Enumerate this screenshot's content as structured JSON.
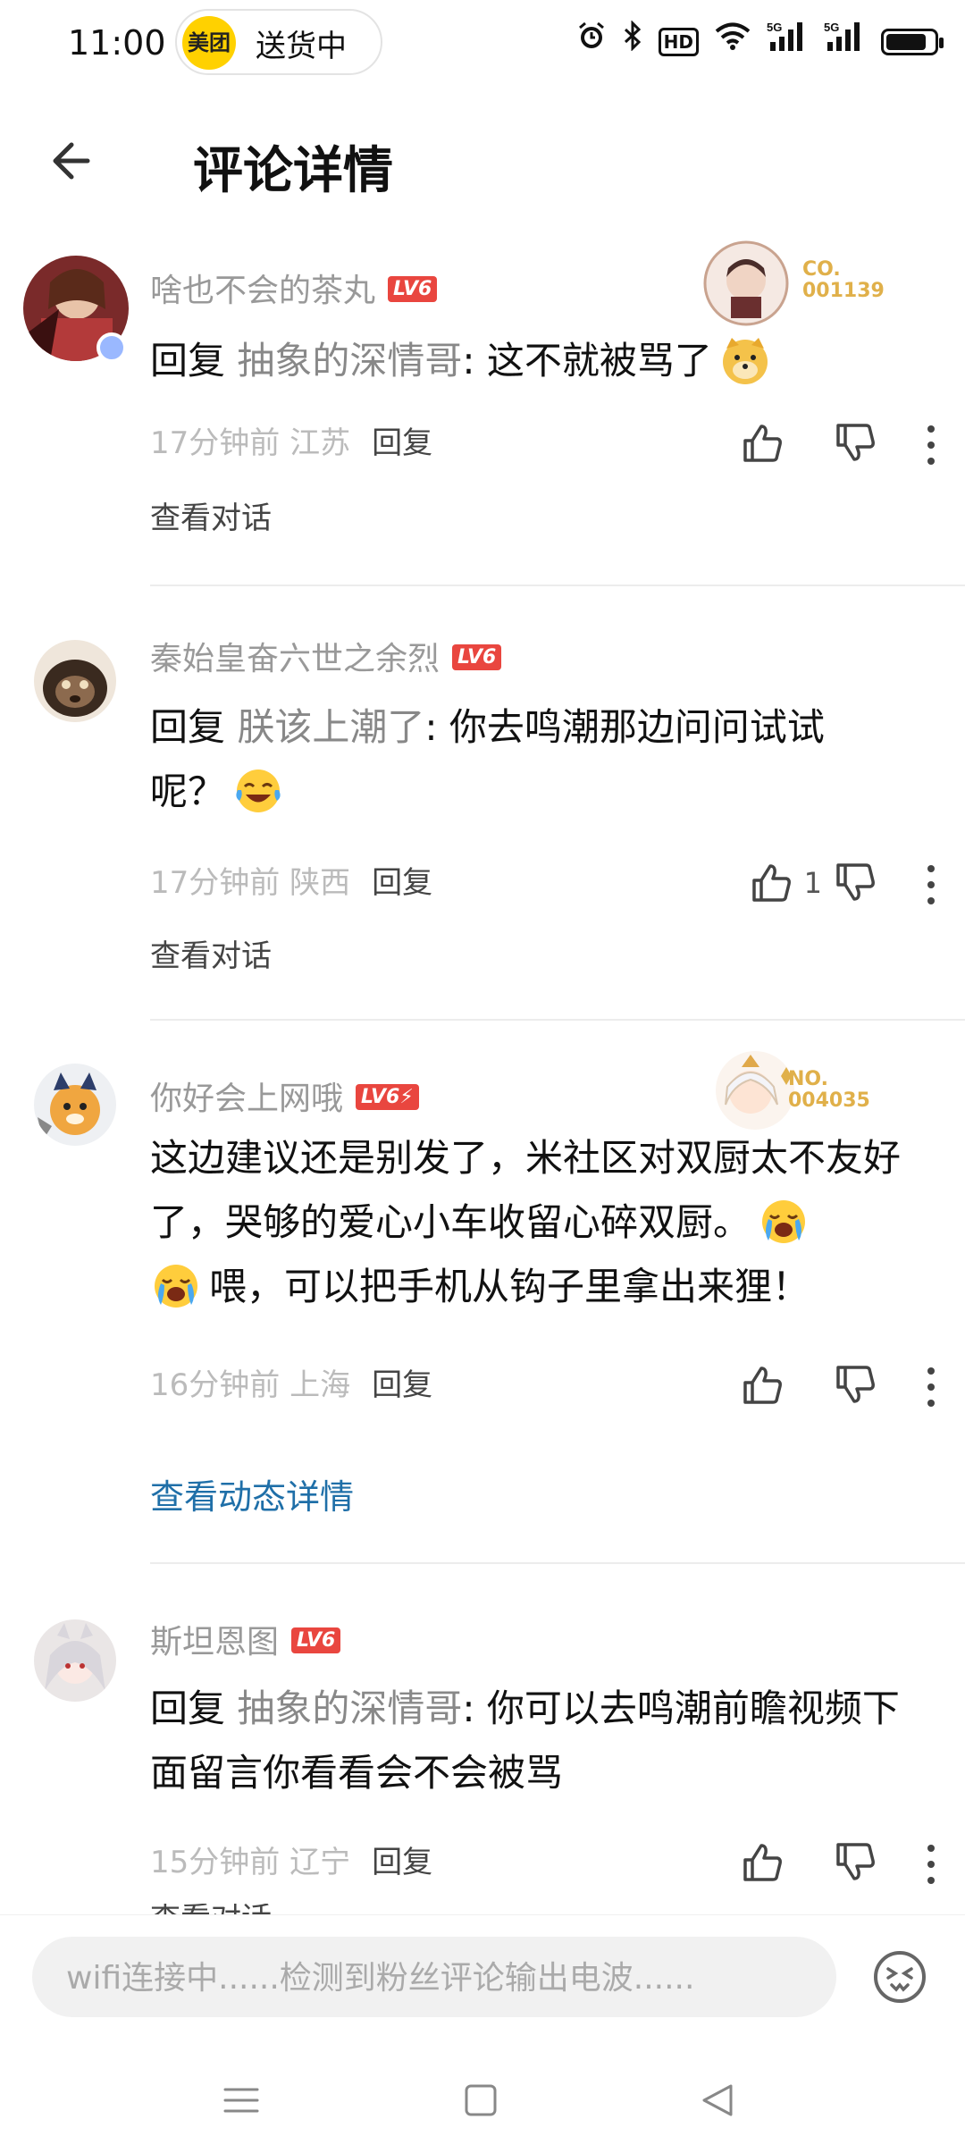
{
  "status_bar": {
    "time": "11:00",
    "pill_logo": "美团",
    "pill_text": "送货中",
    "icons": [
      "alarm-icon",
      "bluetooth-icon",
      "hd-icon",
      "wifi-icon",
      "signal-5g-icon",
      "signal-5g-icon",
      "battery-icon"
    ],
    "hd_label": "HD",
    "signal_label": "5G",
    "battery_level": 0.85
  },
  "header": {
    "title": "评论详情"
  },
  "comments": [
    {
      "username": "啥也不会的茶丸",
      "level": "LV6",
      "verified": true,
      "badge_no": "CO.\n001139",
      "reply_prefix": "回复 ",
      "reply_to": "抽象的深情哥",
      "text": ": 这不就被骂了",
      "emoji": "doge-emoji",
      "time": "17分钟前",
      "location": "江苏",
      "reply_label": "回复",
      "like_count": "",
      "footer_link": "查看对话"
    },
    {
      "username": "秦始皇奋六世之余烈",
      "level": "LV6",
      "verified": false,
      "badge_no": "",
      "reply_prefix": "回复 ",
      "reply_to": "朕该上潮了",
      "text": ": 你去鸣潮那边问问试试呢？",
      "emoji": "laugh-cry-emoji",
      "time": "17分钟前",
      "location": "陕西",
      "reply_label": "回复",
      "like_count": "1",
      "footer_link": "查看对话"
    },
    {
      "username": "你好会上网哦",
      "level": "LV6⚡",
      "verified": false,
      "badge_no": "NO.\n004035",
      "reply_prefix": "",
      "reply_to": "",
      "text_part1": "这边建议还是别发了，米社区对双厨太不友好了，哭够的爱心小车收留心碎双厨。",
      "text_part2": "喂，可以把手机从钩子里拿出来狸！",
      "emoji": "crying-emoji",
      "time": "16分钟前",
      "location": "上海",
      "reply_label": "回复",
      "like_count": "",
      "footer_link": "查看动态详情"
    },
    {
      "username": "斯坦恩图",
      "level": "LV6",
      "verified": false,
      "badge_no": "",
      "reply_prefix": "回复 ",
      "reply_to": "抽象的深情哥",
      "text": ": 你可以去鸣潮前瞻视频下面留言你看看会不会被骂",
      "emoji": "",
      "time": "15分钟前",
      "location": "辽宁",
      "reply_label": "回复",
      "like_count": "",
      "footer_link": "查看对话"
    }
  ],
  "input": {
    "placeholder": "wifi连接中......检测到粉丝评论输出电波......"
  },
  "nav_bar": {
    "buttons": [
      "menu-icon",
      "home-icon",
      "back-triangle-icon"
    ]
  }
}
